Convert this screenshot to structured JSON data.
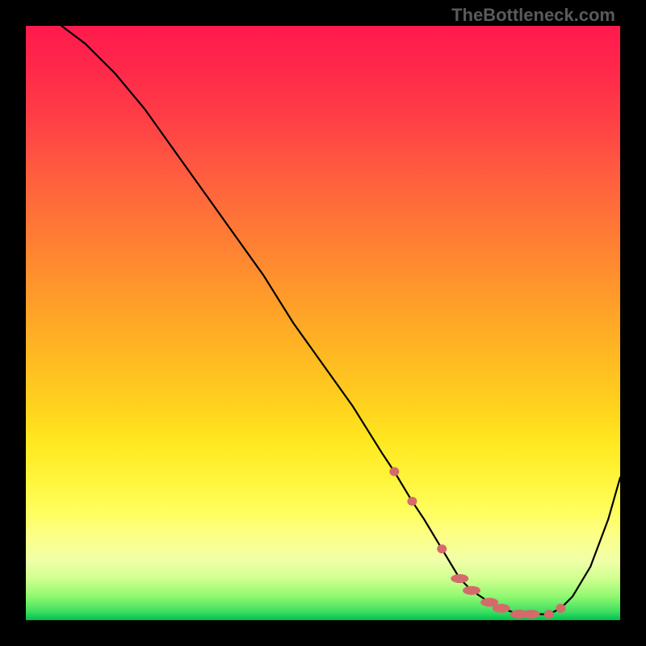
{
  "watermark": "TheBottleneck.com",
  "chart_data": {
    "type": "line",
    "title": "",
    "xlabel": "",
    "ylabel": "",
    "xlim": [
      0,
      100
    ],
    "ylim": [
      0,
      100
    ],
    "grid": false,
    "gradient_colors_top_to_bottom": [
      "#ff1a4d",
      "#ff8a30",
      "#ffe820",
      "#00c050"
    ],
    "series": [
      {
        "name": "bottleneck-curve",
        "color": "#000000",
        "x": [
          6,
          10,
          15,
          20,
          25,
          30,
          35,
          40,
          45,
          50,
          55,
          60,
          62,
          65,
          67,
          70,
          73,
          75,
          78,
          80,
          83,
          85,
          88,
          90,
          92,
          95,
          98,
          100
        ],
        "values": [
          100,
          97,
          92,
          86,
          79,
          72,
          65,
          58,
          50,
          43,
          36,
          28,
          25,
          20,
          17,
          12,
          7,
          5,
          3,
          2,
          1,
          1,
          1,
          2,
          4,
          9,
          17,
          24
        ]
      }
    ],
    "markers": [
      {
        "name": "curve-dots",
        "color": "#d46a6a",
        "shape": "oval",
        "x": [
          62,
          65,
          70,
          73,
          75,
          78,
          80,
          83,
          85,
          88,
          90
        ],
        "y": [
          25,
          20,
          12,
          7,
          5,
          3,
          2,
          1,
          1,
          1,
          2
        ]
      }
    ]
  }
}
